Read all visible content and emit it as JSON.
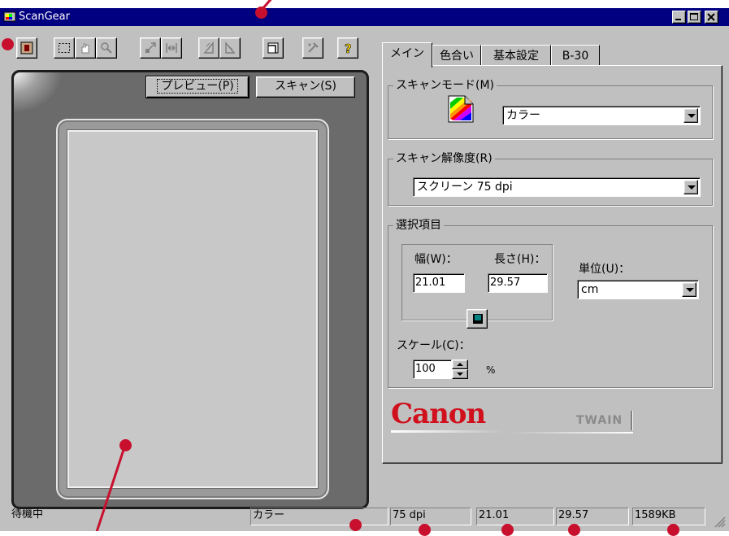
{
  "window": {
    "title": "ScanGear"
  },
  "toolbar": {
    "buttons": [
      "stop-icon",
      "select-icon",
      "hand-icon",
      "zoom-icon",
      "fit-icon",
      "expand-icon",
      "rotate-left-icon",
      "rotate-right-icon",
      "frame-icon",
      "auto-icon",
      "help-icon"
    ]
  },
  "preview": {
    "preview_label": "プレビュー(P)",
    "scan_label": "スキャン(S)"
  },
  "tabs": [
    "メイン",
    "色合い",
    "基本設定",
    "B-30"
  ],
  "main": {
    "scan_mode_title": "スキャンモード(M)",
    "scan_mode_value": "カラー",
    "resolution_title": "スキャン解像度(R)",
    "resolution_value": "スクリーン 75 dpi",
    "options_title": "選択項目",
    "width_label": "幅(W)：",
    "width_value": "21.01",
    "height_label": "長さ(H)：",
    "height_value": "29.57",
    "unit_label": "単位(U)：",
    "unit_value": "cm",
    "scale_label": "スケール(C)：",
    "scale_value": "100",
    "scale_unit": "%",
    "brand": "Canon",
    "twain": "TWAIN"
  },
  "status": {
    "state": "待機中",
    "mode": "カラー",
    "dpi": "75 dpi",
    "width": "21.01",
    "height": "29.57",
    "size": "1589KB"
  },
  "colors": {
    "titlebar": "#000080",
    "face": "#c0c0c0",
    "callout": "#c8102e",
    "brand": "#d0101c"
  }
}
